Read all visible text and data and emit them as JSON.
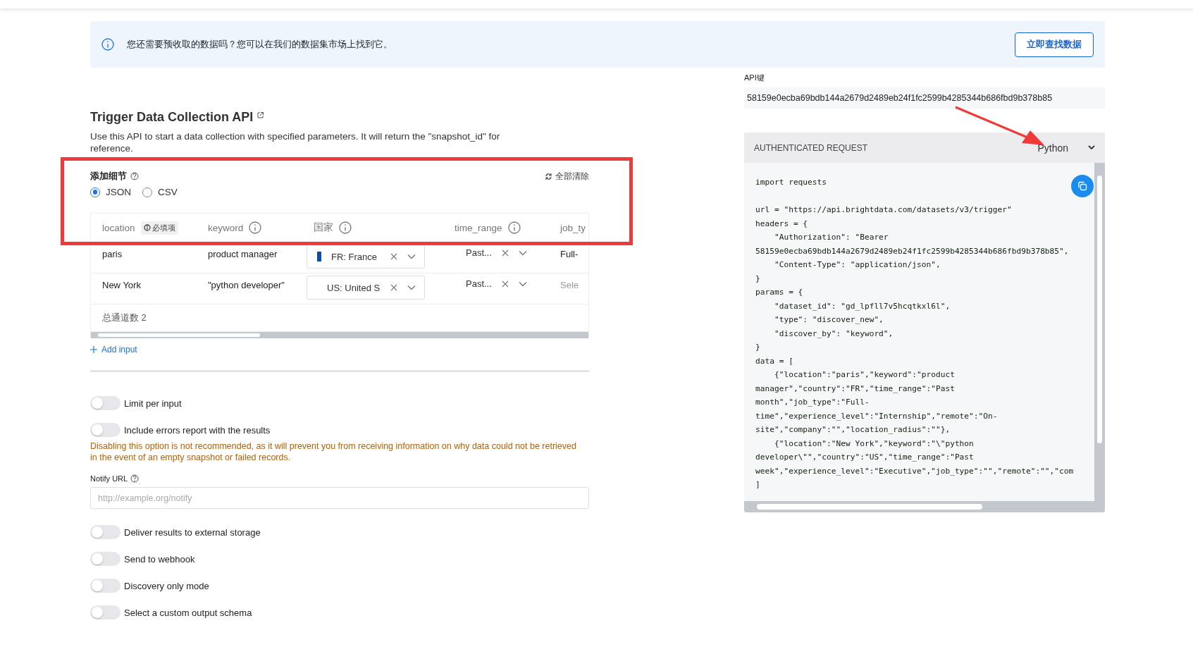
{
  "banner": {
    "text": "您还需要预收取的数据吗？您可以在我们的数据集市场上找到它。",
    "button": "立即查找数据"
  },
  "api_section": {
    "title": "Trigger Data Collection API",
    "description": "Use this API to start a data collection with specified parameters. It will return the \"snapshot_id\" for reference."
  },
  "details": {
    "title": "添加细节",
    "clear_all": "全部清除",
    "formats": [
      {
        "label": "JSON",
        "selected": true
      },
      {
        "label": "CSV",
        "selected": false
      }
    ]
  },
  "table": {
    "columns": [
      {
        "label": "location",
        "badge": "必填项"
      },
      {
        "label": "keyword"
      },
      {
        "label": "国家"
      },
      {
        "label": "time_range"
      },
      {
        "label": "job_ty"
      }
    ],
    "rows": [
      {
        "cells": [
          {
            "kind": "text",
            "text": "paris"
          },
          {
            "kind": "text",
            "text": "product manager"
          },
          {
            "kind": "select",
            "value": "FR: France",
            "flag": true
          },
          {
            "kind": "compact",
            "value": "Past..."
          },
          {
            "kind": "text",
            "text": "Full-"
          }
        ]
      },
      {
        "cells": [
          {
            "kind": "text",
            "text": "New York"
          },
          {
            "kind": "text",
            "text": "\"python developer\""
          },
          {
            "kind": "select",
            "value": "US: United S",
            "flag": false
          },
          {
            "kind": "compact",
            "value": "Past..."
          },
          {
            "kind": "placeholder",
            "text": "Sele"
          }
        ]
      }
    ],
    "footer": "总通道数 2"
  },
  "add_input": "Add input",
  "options": [
    {
      "kind": "toggle",
      "label": "Limit per input",
      "on": false
    },
    {
      "kind": "toggle",
      "label": "Include errors report with the results",
      "on": false
    },
    {
      "kind": "warning",
      "text": "Disabling this option is not recommended, as it will prevent you from receiving information on why data could not be retrieved in the event of an empty snapshot or failed records."
    },
    {
      "kind": "field",
      "label": "Notify URL",
      "placeholder": "http://example.org/notify"
    },
    {
      "kind": "toggle",
      "label": "Deliver results to external storage",
      "on": false
    },
    {
      "kind": "toggle",
      "label": "Send to webhook",
      "on": false
    },
    {
      "kind": "toggle",
      "label": "Discovery only mode",
      "on": false
    },
    {
      "kind": "toggle",
      "label": "Select a custom output schema",
      "on": false
    }
  ],
  "api_key": {
    "label": "API键",
    "value": "58159e0ecba69bdb144a2679d2489eb24f1fc2599b4285344b686fbd9b378b85"
  },
  "request": {
    "title": "AUTHENTICATED REQUEST",
    "language": "Python",
    "code_blocks": [
      [
        "import requests"
      ],
      [
        "url = \"https://api.brightdata.com/datasets/v3/trigger\"",
        "headers = {",
        "    \"Authorization\": \"Bearer",
        "58159e0ecba69bdb144a2679d2489eb24f1fc2599b4285344b686fbd9b378b85\",",
        "    \"Content-Type\": \"application/json\",",
        "}",
        "params = {",
        "    \"dataset_id\": \"gd_lpfll7v5hcqtkxl6l\",",
        "    \"type\": \"discover_new\",",
        "    \"discover_by\": \"keyword\",",
        "}",
        "data = [",
        "    {\"location\":\"paris\",\"keyword\":\"product",
        "manager\",\"country\":\"FR\",\"time_range\":\"Past",
        "month\",\"job_type\":\"Full-",
        "time\",\"experience_level\":\"Internship\",\"remote\":\"On-",
        "site\",\"company\":\"\",\"location_radius\":\"\"},",
        "    {\"location\":\"New York\",\"keyword\":\"\\\"python",
        "developer\\\"\",\"country\":\"US\",\"time_range\":\"Past",
        "week\",\"experience_level\":\"Executive\",\"job_type\":\"\",\"remote\":\"\",\"com",
        "]"
      ]
    ]
  },
  "annotations": {
    "highlight_box": true,
    "arrow": true
  }
}
